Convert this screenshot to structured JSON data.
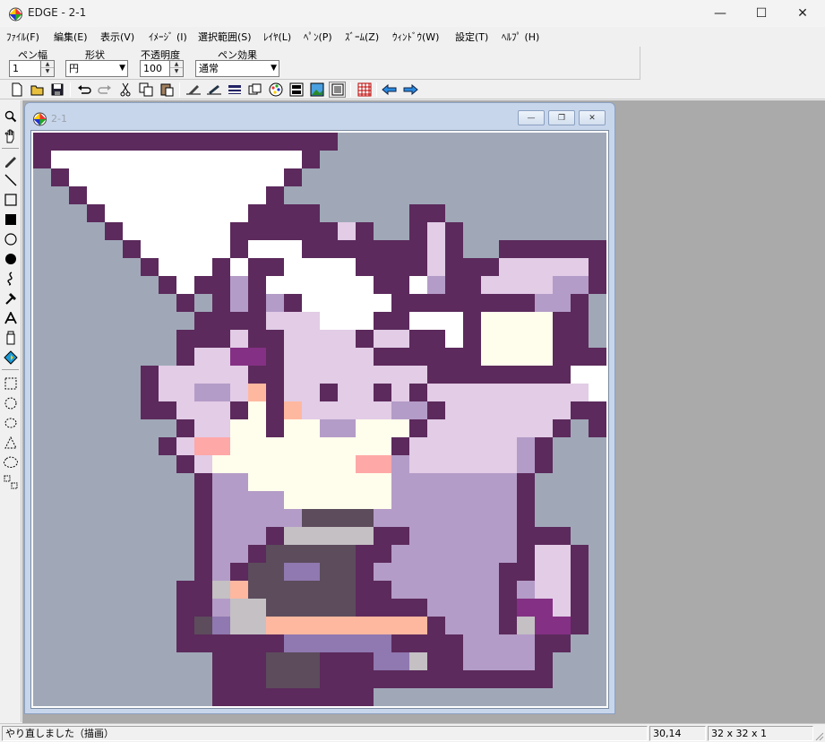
{
  "window": {
    "title": "EDGE - 2-1",
    "minimize_glyph": "—",
    "maximize_glyph": "☐",
    "close_glyph": "✕"
  },
  "menu": [
    "ﾌｧｲﾙ(F)",
    "編集(E)",
    "表示(V)",
    "ｲﾒｰｼﾞ (I)",
    "選択範囲(S)",
    "ﾚｲﾔ(L)",
    "ﾍﾟﾝ(P)",
    "ｽﾞｰﾑ(Z)",
    "ｳｨﾝﾄﾞｳ(W)",
    "設定(T)",
    "ﾍﾙﾌﾟ (H)"
  ],
  "pen_options": {
    "width_label": "ペン幅",
    "width_value": "1",
    "shape_label": "形状",
    "shape_value": "円",
    "opacity_label": "不透明度",
    "opacity_value": "100",
    "effect_label": "ペン効果",
    "effect_value": "通常"
  },
  "toolbar_icons": [
    "new-file-icon",
    "open-folder-icon",
    "save-icon",
    "undo-icon",
    "redo-icon",
    "cut-icon",
    "copy-icon",
    "paste-icon",
    "pen-settings-icon",
    "brush-settings-icon",
    "line-pattern-icon",
    "layers-icon",
    "palette-icon",
    "film-icon",
    "image-icon",
    "preview-icon",
    "grid-icon",
    "prev-window-icon",
    "next-window-icon"
  ],
  "tools": [
    "zoom-icon",
    "hand-icon",
    "pencil-icon",
    "line-icon",
    "rectangle-icon",
    "filled-rectangle-icon",
    "ellipse-icon",
    "filled-ellipse-icon",
    "curve-icon",
    "hammer-icon",
    "text-icon",
    "bucket-icon",
    "fill-icon",
    "rect-select-icon",
    "ellipse-select-icon",
    "lasso-icon",
    "polygon-select-icon",
    "magic-select-icon",
    "pattern-select-icon"
  ],
  "document": {
    "title": "2-1",
    "minimize_glyph": "—",
    "restore_glyph": "❐",
    "close_glyph": "✕"
  },
  "colors": {
    "background": "#a0a8b8",
    "outline": "#5c2a5c",
    "white": "#ffffff",
    "light_lilac": "#e2cce6",
    "lilac": "#b49cc8",
    "magenta": "#843084",
    "peach": "#ffb8a0",
    "pink": "#ffa8a8",
    "cream": "#fffeec",
    "dark_gray": "#5c4c5c",
    "light_gray": "#c4c0c4",
    "purple": "#9078b0"
  },
  "pixel_rows": [
    "XXXXXXXXXXXXXXXXX...............",
    "XWWWWWWWWWWWWWWX................",
    ".XWWWWWWWWWWWWX.................",
    "..XWWWWWWWWWWX..................",
    "...XWWWWWWWWXXXX.....XX.........",
    "....XWWWWWWXXXXXXLX..XLX........",
    ".....XWWWWWXWWWXXXXXXXLX..XXXXXX",
    "......XWWWXWXXWWWWXXXXLXXXLLLLLX",
    ".......XWXXPXWWWWWWXXWPXXLLLLPPX",
    "........X.XPXPXWWWWWXXXXXXXXPPX.",
    ".........XXXXLLLWWWXXWWWXCCCCXX.",
    "........XXXLXXLLLLXLLXXWXCCCCXX.",
    "........XLLMMXLLLLLXXXXXXCCCCXXXX",
    "......XLLLLLXXLLLLLLLLXXXXXXXXWWX",
    "......XLLPPLKXLLXLLXLXLLLLLLLLLWWX",
    "......XXLLLXCXKLLLLLPPXLLLLLLLXXXX",
    "........XLLCCXCCPPCCCXLLLLLLLX.XX",
    ".......XLAACCCCCCCCCXLLLLLLPX....",
    "........XLCCCCCCCCAAPLLLLLLPX....",
    ".........XPPCCCCCCCCPPPPPPPX.....",
    ".........XPPPPCCCCCCPPPPPPPX.....",
    ".........XPPPPPDDDDPPPPPPPPX.....",
    ".........XPPPXGGGGGXXPPPPPPXXX...",
    ".........XPPXDDDDDXXPPPPPPPXLLX..",
    ".........XPXDDUUDDXPPPPPPPXXLLX..",
    "........XXGKDDDDDDXXPPPPPPXPLLX..",
    "........XXPGGDDDDDXXXXPPPPXMMLX..",
    "........XDUGGKKKKKKKKKXPPPXGMMX..",
    "........XXXXXXUUUUUUXXXXPPPPXX...",
    "..........XXXDDDXXXUUGXXPPPPX....",
    "..........XXXDDDXXXXXXXXXXXXX....",
    "..........XXXXXXXXX.............."
  ],
  "status": {
    "message": "やり直しました（描画）",
    "position": "30,14",
    "size": "32 x 32 x 1"
  }
}
